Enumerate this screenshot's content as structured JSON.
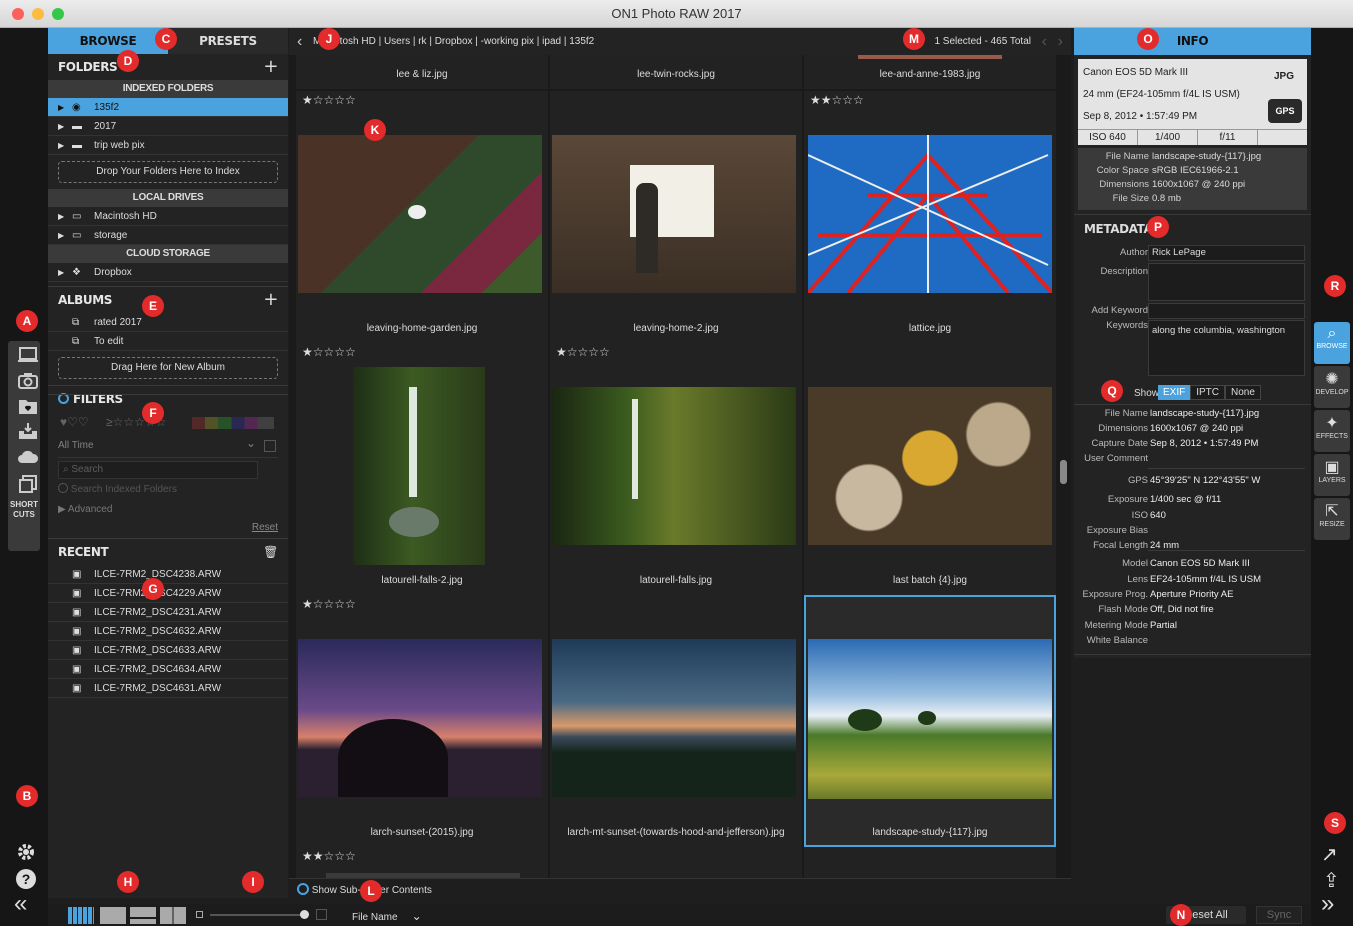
{
  "window": {
    "title": "ON1 Photo RAW 2017"
  },
  "markers": {
    "a": "A",
    "b": "B",
    "c": "C",
    "d": "D",
    "e": "E",
    "f": "F",
    "g": "G",
    "h": "H",
    "i": "I",
    "j": "J",
    "k": "K",
    "l": "L",
    "m": "M",
    "n": "N",
    "o": "O",
    "p": "P",
    "q": "Q",
    "r": "R",
    "s": "S"
  },
  "left_rail": {
    "shortcuts_label_1": "SHORT",
    "shortcuts_label_2": "CUTS"
  },
  "left_panel": {
    "tabs": {
      "browse": "BROWSE",
      "presets": "PRESETS"
    },
    "folders": {
      "title": "FOLDERS",
      "indexed_header": "INDEXED FOLDERS",
      "indexed": [
        "135f2",
        "2017",
        "trip web pix"
      ],
      "drop_label": "Drop Your Folders Here to Index",
      "local_header": "LOCAL DRIVES",
      "local": [
        "Macintosh HD",
        "storage"
      ],
      "cloud_header": "CLOUD STORAGE",
      "cloud": [
        "Dropbox"
      ]
    },
    "albums": {
      "title": "ALBUMS",
      "items": [
        "rated 2017",
        "To edit"
      ],
      "drag_label": "Drag Here for New Album"
    },
    "filters": {
      "title": "FILTERS",
      "time": "All Time",
      "search_placeholder": "Search",
      "search_indexed": "Search Indexed Folders",
      "advanced": "Advanced",
      "reset": "Reset"
    },
    "recent": {
      "title": "RECENT",
      "items": [
        "ILCE-7RM2_DSC4238.ARW",
        "ILCE-7RM2_DSC4229.ARW",
        "ILCE-7RM2_DSC4231.ARW",
        "ILCE-7RM2_DSC4632.ARW",
        "ILCE-7RM2_DSC4633.ARW",
        "ILCE-7RM2_DSC4634.ARW",
        "ILCE-7RM2_DSC4631.ARW"
      ]
    }
  },
  "breadcrumb": {
    "path": "Macintosh HD | Users | rk | Dropbox | -working pix | ipad | 135f2",
    "selection": "1 Selected - 465 Total"
  },
  "grid": {
    "top_row": [
      "lee & liz.jpg",
      "lee-twin-rocks.jpg",
      "lee-and-anne-1983.jpg"
    ],
    "cells": [
      {
        "name": "leaving-home-garden.jpg",
        "stars": "★☆☆☆☆",
        "rating": 1
      },
      {
        "name": "leaving-home-2.jpg",
        "stars": "",
        "rating": 0
      },
      {
        "name": "lattice.jpg",
        "stars": "★★☆☆☆",
        "rating": 2
      },
      {
        "name": "latourell-falls-2.jpg",
        "stars": "★☆☆☆☆",
        "rating": 1
      },
      {
        "name": "latourell-falls.jpg",
        "stars": "★☆☆☆☆",
        "rating": 1
      },
      {
        "name": "last batch {4}.jpg",
        "stars": "",
        "rating": 0
      },
      {
        "name": "larch-sunset-(2015).jpg",
        "stars": "★☆☆☆☆",
        "rating": 1
      },
      {
        "name": "larch-mt-sunset-(towards-hood-and-jefferson).jpg",
        "stars": "",
        "rating": 0
      },
      {
        "name": "landscape-study-{117}.jpg",
        "stars": "",
        "rating": 0
      }
    ],
    "next_row_stars": "★★☆☆☆",
    "subfolder_label": "Show Sub-Folder Contents"
  },
  "bottom": {
    "sort": "File Name",
    "reset_all": "Reset All",
    "sync": "Sync"
  },
  "info": {
    "tab": "INFO",
    "camera": "Canon EOS 5D Mark III",
    "lens": "24 mm (EF24-105mm f/4L IS USM)",
    "date": "Sep 8, 2012 • 1:57:49 PM",
    "format": "JPG",
    "gps_badge": "GPS",
    "iso": "ISO 640",
    "shutter": "1/400",
    "aperture": "f/11",
    "file_name_label": "File Name",
    "file_name": "landscape-study-{117}.jpg",
    "color_space_label": "Color Space",
    "color_space": "sRGB IEC61966-2.1",
    "dimensions_label": "Dimensions",
    "dimensions": "1600x1067 @ 240 ppi",
    "file_size_label": "File Size",
    "file_size": "0.8 mb"
  },
  "metadata": {
    "title": "METADATA",
    "author_label": "Author",
    "author": "Rick LePage",
    "description_label": "Description",
    "add_keyword_label": "Add Keyword",
    "keywords_label": "Keywords",
    "keywords": "along the columbia, washington",
    "show_label": "Show",
    "show_options": [
      "EXIF",
      "IPTC",
      "None"
    ],
    "exif": [
      {
        "label": "File Name",
        "value": "landscape-study-{117}.jpg"
      },
      {
        "label": "Dimensions",
        "value": "1600x1067 @ 240 ppi"
      },
      {
        "label": "Capture Date",
        "value": "Sep 8, 2012 • 1:57:49 PM"
      },
      {
        "label": "User Comment",
        "value": ""
      },
      {
        "label": "GPS",
        "value": "45°39'25\" N 122°43'55\" W"
      },
      {
        "label": "Exposure",
        "value": "1/400 sec @ f/11"
      },
      {
        "label": "ISO",
        "value": "640"
      },
      {
        "label": "Exposure Bias",
        "value": ""
      },
      {
        "label": "Focal Length",
        "value": "24 mm"
      },
      {
        "label": "Model",
        "value": "Canon EOS 5D Mark III"
      },
      {
        "label": "Lens",
        "value": "EF24-105mm f/4L IS USM"
      },
      {
        "label": "Exposure Prog.",
        "value": "Aperture Priority AE"
      },
      {
        "label": "Flash Mode",
        "value": "Off, Did not fire"
      },
      {
        "label": "Metering Mode",
        "value": "Partial"
      },
      {
        "label": "White Balance",
        "value": ""
      }
    ]
  },
  "modules": {
    "browse": "BROWSE",
    "develop": "DEVELOP",
    "effects": "EFFECTS",
    "layers": "LAYERS",
    "resize": "RESIZE"
  },
  "colors": {
    "accent": "#4aa3df",
    "marker": "#e32b2b"
  }
}
